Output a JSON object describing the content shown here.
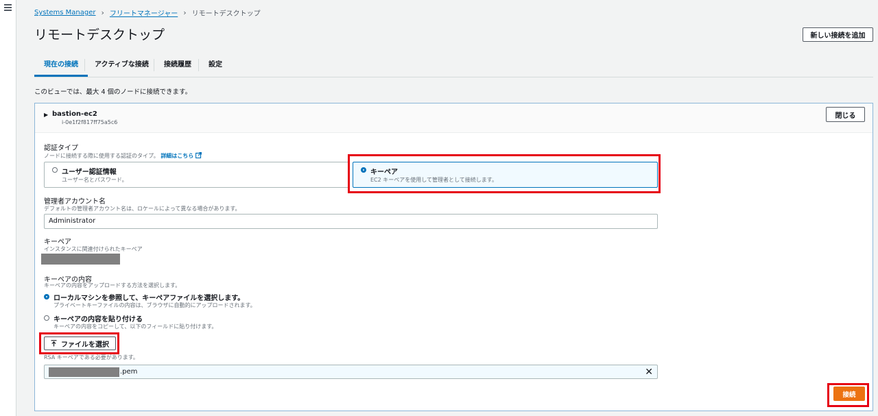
{
  "breadcrumb": [
    "Systems Manager",
    "フリートマネージャー",
    "リモートデスクトップ"
  ],
  "page_title": "リモートデスクトップ",
  "add_connection_label": "新しい接続を追加",
  "tabs": [
    {
      "label": "現在の接続",
      "active": true
    },
    {
      "label": "アクティブな接続",
      "active": false
    },
    {
      "label": "接続履歴",
      "active": false
    },
    {
      "label": "設定",
      "active": false
    }
  ],
  "info_text": "このビューでは、最大 4 個のノードに接続できます。",
  "node": {
    "name": "bastion-ec2",
    "instance_id": "i-0e1f2f817ff75a5c6",
    "close_label": "閉じる"
  },
  "auth_type": {
    "label": "認証タイプ",
    "description": "ノードに接続する際に使用する認証のタイプ。",
    "details_link": "詳細はこちら",
    "options": [
      {
        "title": "ユーザー認証情報",
        "desc": "ユーザー名とパスワード。",
        "selected": false
      },
      {
        "title": "キーペア",
        "desc": "EC2 キーペアを使用して管理者として接続します。",
        "selected": true
      }
    ]
  },
  "admin_account": {
    "label": "管理者アカウント名",
    "description": "デフォルトの管理者アカウント名は、ロケールによって異なる場合があります。",
    "value": "Administrator"
  },
  "keypair": {
    "label": "キーペア",
    "description": "インスタンスに関連付けられたキーペア"
  },
  "keypair_content": {
    "label": "キーペアの内容",
    "description": "キーペアの内容をアップロードする方法を選択します。",
    "options": [
      {
        "title": "ローカルマシンを参照して、キーペアファイルを選択します。",
        "desc": "プライベートキーファイルの内容は、ブラウザに自動的にアップロードされます。",
        "selected": true
      },
      {
        "title": "キーペアの内容を貼り付ける",
        "desc": "キーペアの内容をコピーして、以下のフィールドに貼り付けます。",
        "selected": false
      }
    ],
    "choose_file_label": "ファイルを選択",
    "rsa_hint": "RSA キーペアである必要があります。",
    "file_name_suffix": ".pem"
  },
  "connect_label": "接続",
  "colors": {
    "accent": "#0073bb",
    "primary_button": "#ec7211",
    "highlight": "#e60012"
  }
}
